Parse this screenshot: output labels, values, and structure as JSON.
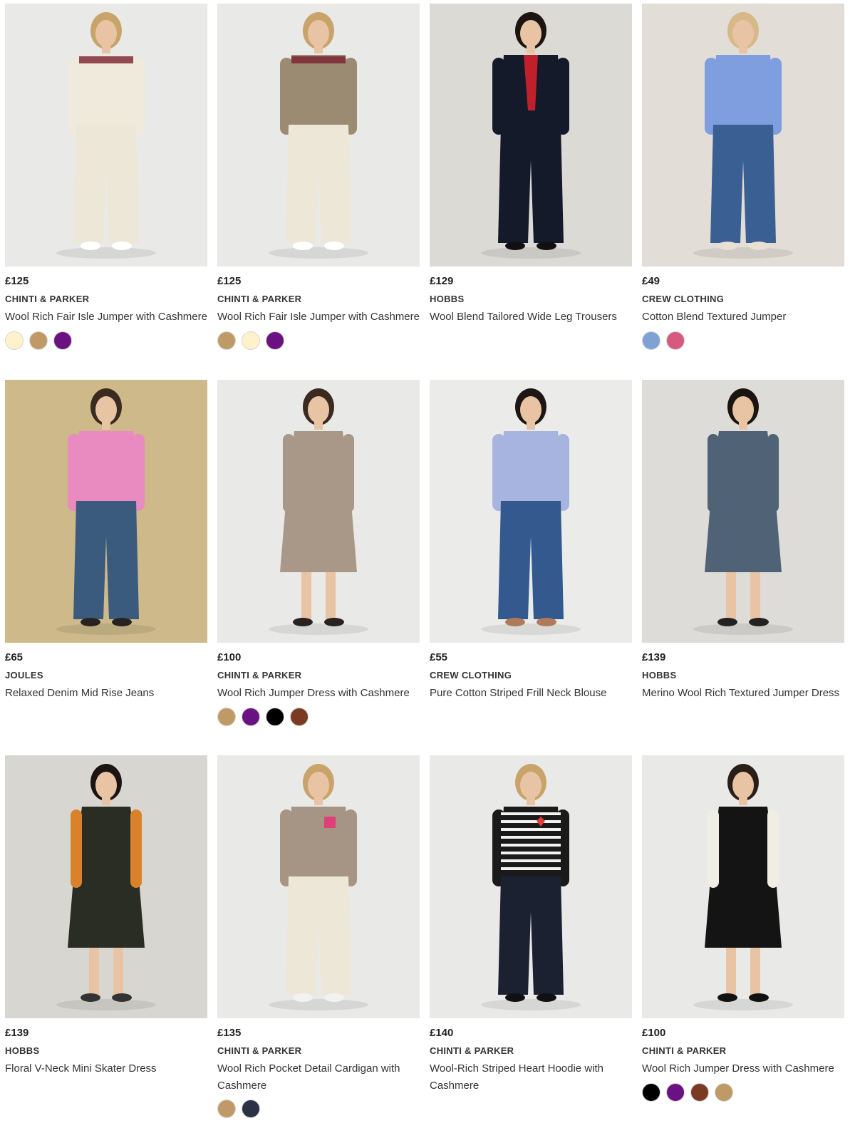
{
  "products": [
    {
      "price": "£125",
      "brand": "CHINTI & PARKER",
      "title": "Wool Rich Fair Isle Jumper with Cashmere",
      "swatches": [
        "#fdf2c9",
        "#c09a66",
        "#6b1283"
      ],
      "bg": "#e9e9e8",
      "top": "#efeadb",
      "bottom": "#ede7d7",
      "hair": "#c9a46a",
      "shoes": "#ffffff",
      "pattern": "#7a2030"
    },
    {
      "price": "£125",
      "brand": "CHINTI & PARKER",
      "title": "Wool Rich Fair Isle Jumper with Cashmere",
      "swatches": [
        "#c09a66",
        "#fdf2c9",
        "#6b1283"
      ],
      "bg": "#e9e9e8",
      "top": "#9b8b73",
      "bottom": "#ede7d7",
      "hair": "#c9a46a",
      "shoes": "#ffffff",
      "pattern": "#7a2030"
    },
    {
      "price": "£129",
      "brand": "HOBBS",
      "title": "Wool Blend Tailored Wide Leg Trousers",
      "swatches": [],
      "bg": "#dcdad5",
      "top": "#141a2a",
      "bottom": "#141a2a",
      "hair": "#1b1410",
      "shoes": "#111111",
      "pattern": "#c0202a"
    },
    {
      "price": "£49",
      "brand": "CREW CLOTHING",
      "title": "Cotton Blend Textured Jumper",
      "swatches": [
        "#7fa2d4",
        "#d55a7e"
      ],
      "bg": "#e2ddd6",
      "top": "#7f9ee0",
      "bottom": "#3a5f93",
      "hair": "#d6b988",
      "shoes": "#e8e0d4",
      "pattern": ""
    },
    {
      "price": "£65",
      "brand": "JOULES",
      "title": "Relaxed Denim Mid Rise Jeans",
      "swatches": [],
      "bg": "#cdb98a",
      "top": "#e98ac0",
      "bottom": "#3b5b7e",
      "hair": "#3a2a20",
      "shoes": "#2a2220",
      "pattern": ""
    },
    {
      "price": "£100",
      "brand": "CHINTI & PARKER",
      "title": "Wool Rich Jumper Dress with Cashmere",
      "swatches": [
        "#c09a66",
        "#6b1283",
        "#000000",
        "#7b3a22"
      ],
      "bg": "#e9e9e8",
      "top": "#a99887",
      "bottom": "#a99887",
      "hair": "#3a2a20",
      "shoes": "#2a2220",
      "pattern": ""
    },
    {
      "price": "£55",
      "brand": "CREW CLOTHING",
      "title": "Pure Cotton Striped Frill Neck Blouse",
      "swatches": [],
      "bg": "#ebebea",
      "top": "#a8b4e0",
      "bottom": "#34598e",
      "hair": "#1e1612",
      "shoes": "#b07a5a",
      "pattern": ""
    },
    {
      "price": "£139",
      "brand": "HOBBS",
      "title": "Merino Wool Rich Textured Jumper Dress",
      "swatches": [],
      "bg": "#dedcd8",
      "top": "#4f6276",
      "bottom": "#4f6276",
      "hair": "#1b1410",
      "shoes": "#222222",
      "pattern": ""
    },
    {
      "price": "£139",
      "brand": "HOBBS",
      "title": "Floral V-Neck Mini Skater Dress",
      "swatches": [],
      "bg": "#d8d6d0",
      "top": "#2a2d24",
      "bottom": "#2a2d24",
      "hair": "#1b1410",
      "shoes": "#333333",
      "pattern": "#d9822b"
    },
    {
      "price": "£135",
      "brand": "CHINTI & PARKER",
      "title": "Wool Rich Pocket Detail Cardigan with Cashmere",
      "swatches": [
        "#c09a66",
        "#2c3148"
      ],
      "bg": "#e9e9e8",
      "top": "#a69584",
      "bottom": "#ede7d7",
      "hair": "#c9a46a",
      "shoes": "#f2f2f2",
      "pattern": "#e0407a"
    },
    {
      "price": "£140",
      "brand": "CHINTI & PARKER",
      "title": "Wool-Rich Striped Heart Hoodie with Cashmere",
      "swatches": [],
      "bg": "#e9e9e8",
      "top": "#1a1a1a",
      "bottom": "#1b2130",
      "hair": "#c9a46a",
      "shoes": "#111111",
      "pattern": "#e33b3b"
    },
    {
      "price": "£100",
      "brand": "CHINTI & PARKER",
      "title": "Wool Rich Jumper Dress with Cashmere",
      "swatches": [
        "#000000",
        "#6b1283",
        "#7b3a22",
        "#c09a66"
      ],
      "bg": "#e9e9e8",
      "top": "#141414",
      "bottom": "#141414",
      "hair": "#2a1e18",
      "shoes": "#111111",
      "pattern": "#f0ede4"
    }
  ]
}
